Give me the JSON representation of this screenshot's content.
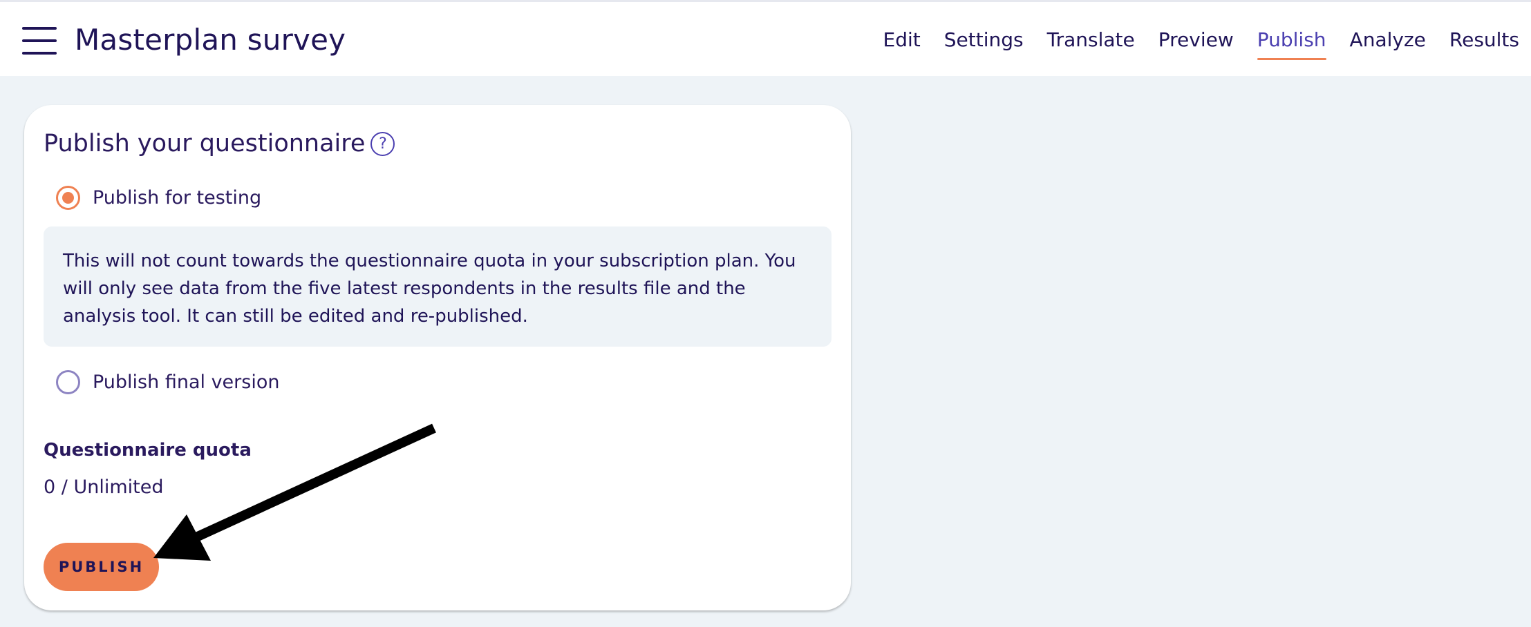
{
  "header": {
    "title": "Masterplan survey",
    "nav": [
      {
        "label": "Edit"
      },
      {
        "label": "Settings"
      },
      {
        "label": "Translate"
      },
      {
        "label": "Preview"
      },
      {
        "label": "Publish",
        "active": true
      },
      {
        "label": "Analyze"
      },
      {
        "label": "Results"
      }
    ]
  },
  "publish": {
    "title": "Publish your questionnaire",
    "help_icon": "?",
    "options": [
      {
        "label": "Publish for testing",
        "selected": true
      },
      {
        "label": "Publish final version",
        "selected": false
      }
    ],
    "info_text": "This will not count towards the questionnaire quota in your subscription plan. You will only see data from the five latest respondents in the results file and the analysis tool. It can still be edited and re-published.",
    "quota_label": "Questionnaire quota",
    "quota_value": "0 / Unlimited",
    "button_label": "PUBLISH"
  },
  "colors": {
    "accent": "#ef8152",
    "primary_text": "#1f1457",
    "active_tab": "#4b3fb0",
    "background": "#eef3f7"
  }
}
